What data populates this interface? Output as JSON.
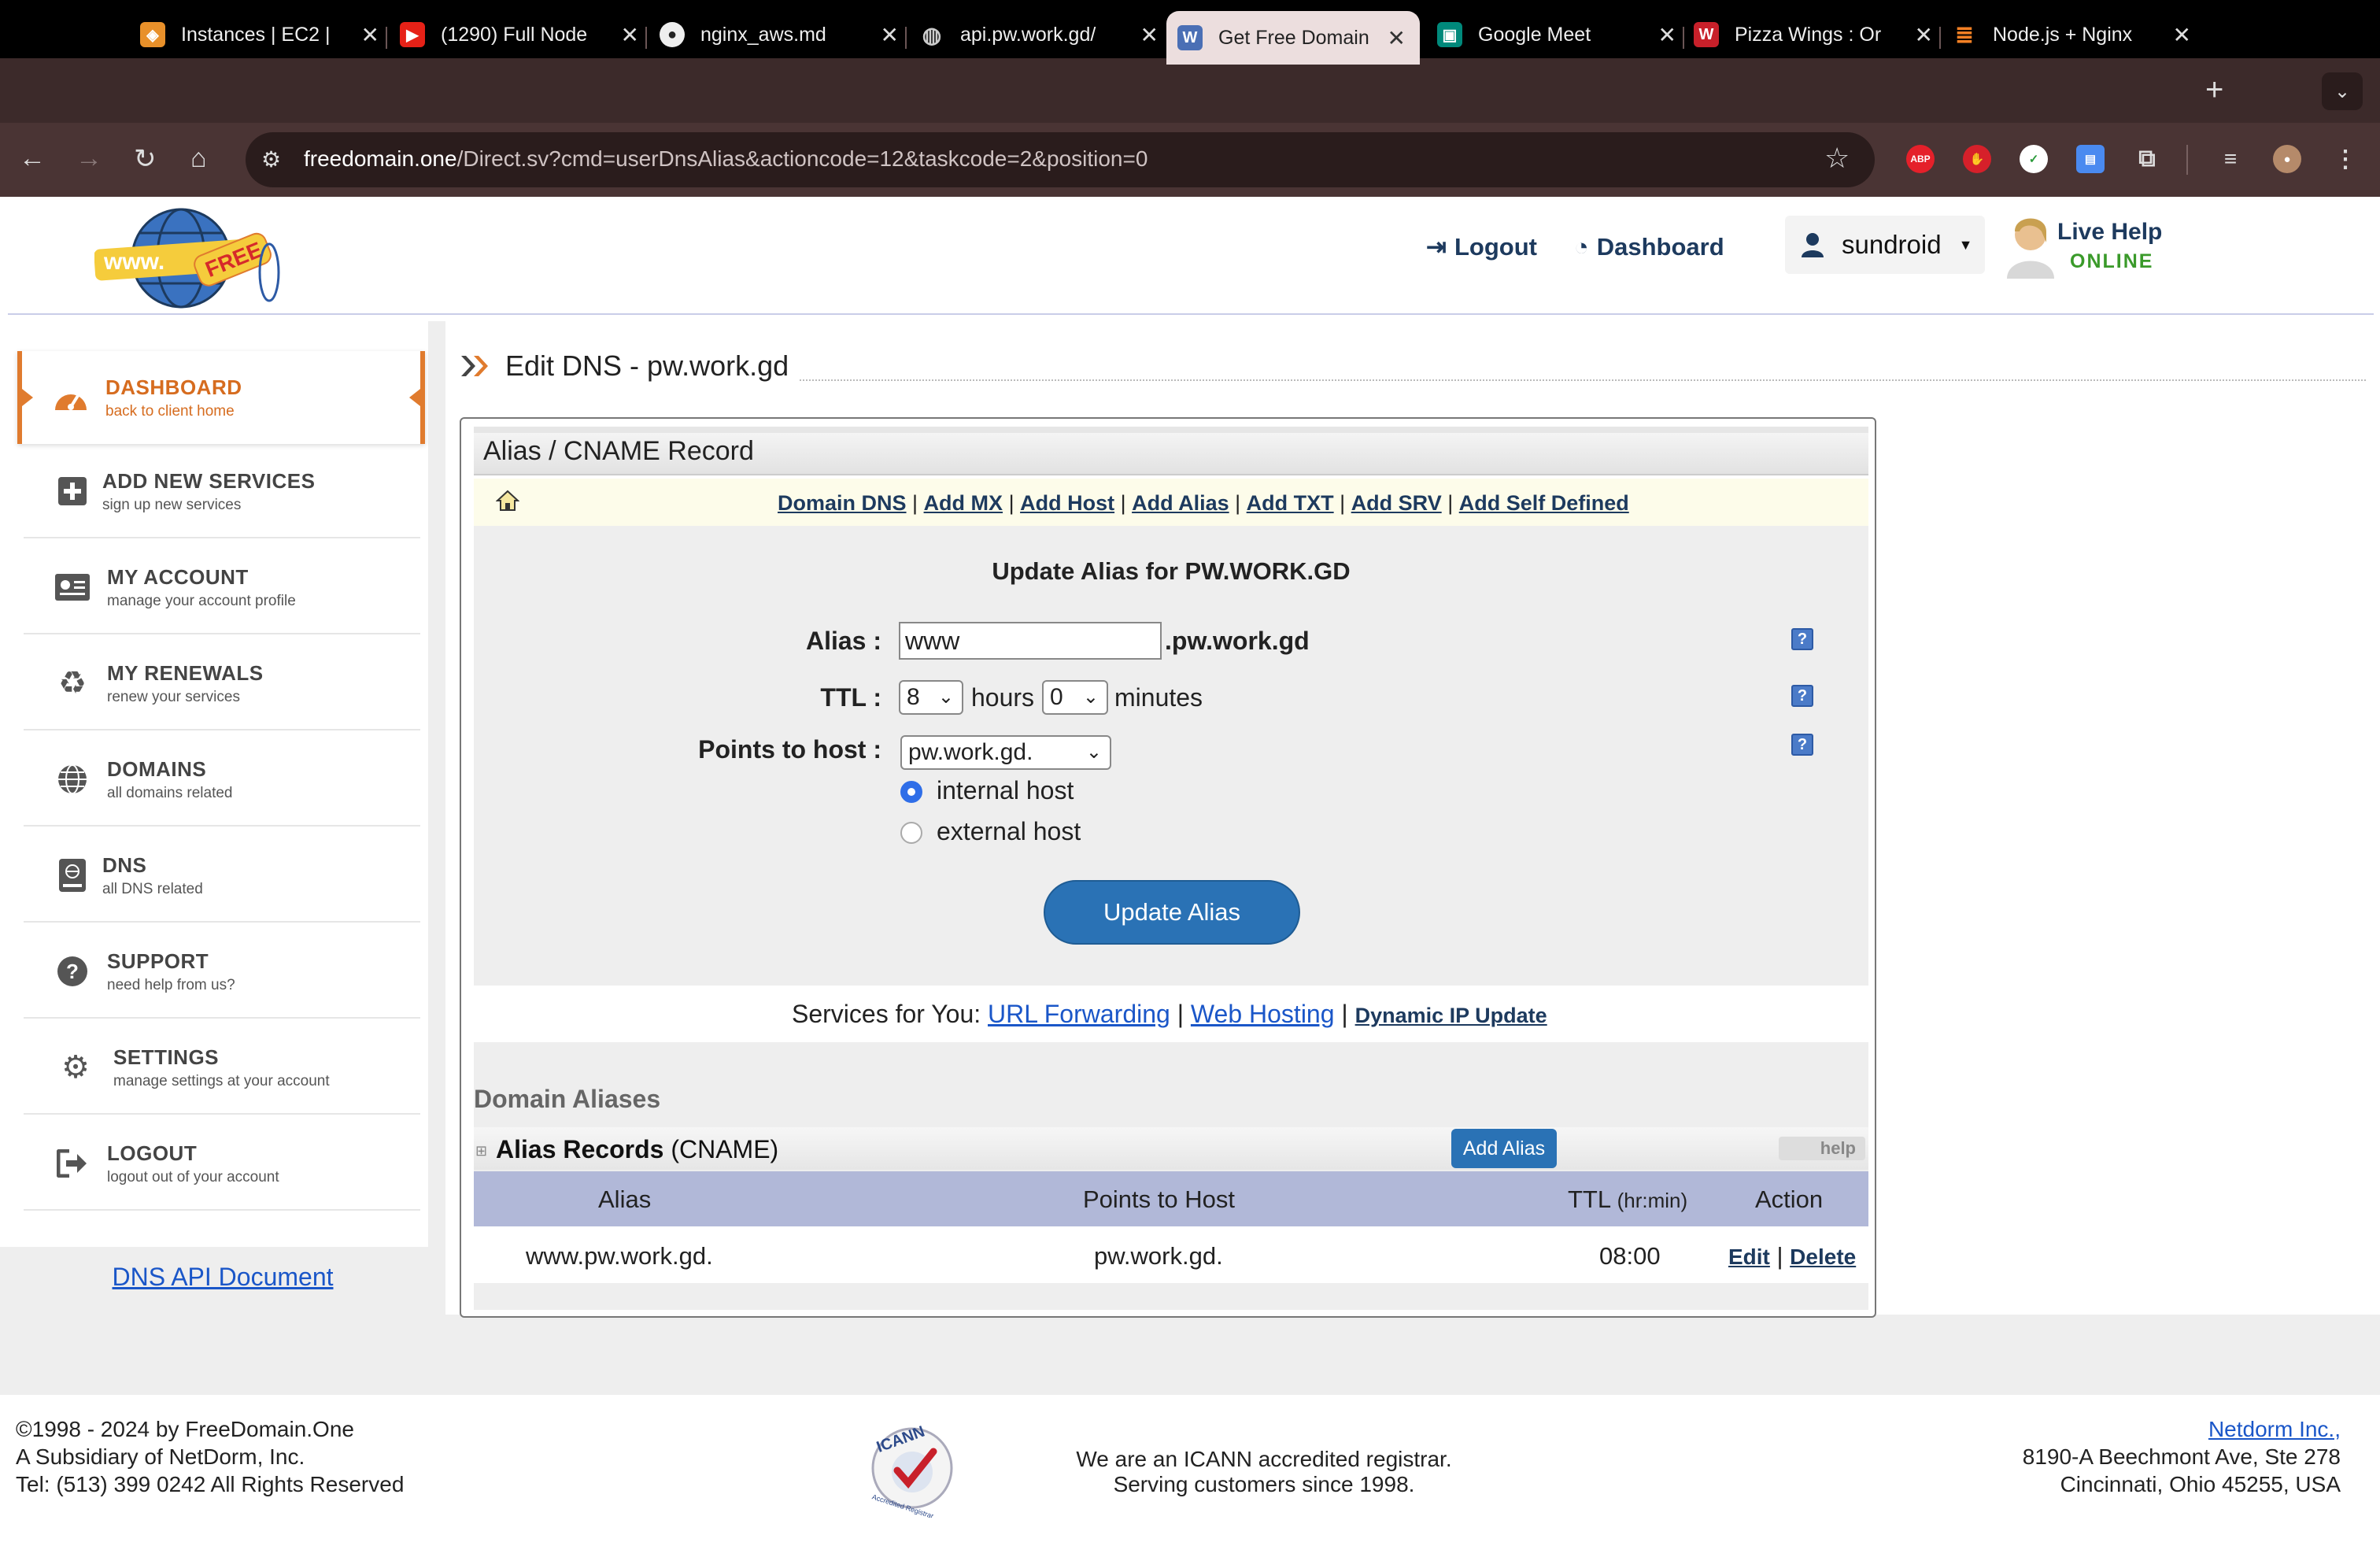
{
  "browser": {
    "tabs": [
      {
        "title": "Instances | EC2 |",
        "icon": "aws-icon",
        "color": "#e8902a"
      },
      {
        "title": "(1290) Full Node",
        "icon": "youtube-icon",
        "color": "#e62117"
      },
      {
        "title": "nginx_aws.md",
        "icon": "github-icon",
        "color": "#eeeeee"
      },
      {
        "title": "api.pw.work.gd/",
        "icon": "globe-icon",
        "color": "#cccccc"
      },
      {
        "title": "Get Free Domain",
        "icon": "freedomain-icon",
        "color": "#4a6fb5",
        "active": true
      },
      {
        "title": "Google Meet",
        "icon": "meet-icon",
        "color": "#00897b"
      },
      {
        "title": "Pizza Wings : Or",
        "icon": "w-icon",
        "color": "#c8202a"
      },
      {
        "title": "Node.js + Nginx",
        "icon": "stackoverflow-icon",
        "color": "#f48024"
      }
    ],
    "url_host": "freedomain.one",
    "url_path": "/Direct.sv?cmd=userDnsAlias&actioncode=12&taskcode=2&position=0",
    "ext_abp": "ABP"
  },
  "header": {
    "logo_text_www": "www.",
    "logo_text_free": "FREE",
    "logout": "Logout",
    "dashboard": "Dashboard",
    "username": "sundroid",
    "live_help": "Live Help",
    "online": "ONLINE"
  },
  "sidebar": {
    "items": [
      {
        "title": "DASHBOARD",
        "sub": "back to client home",
        "icon": "speedometer-icon"
      },
      {
        "title": "ADD NEW SERVICES",
        "sub": "sign up new services",
        "icon": "plus-square-icon"
      },
      {
        "title": "MY ACCOUNT",
        "sub": "manage your account profile",
        "icon": "id-card-icon"
      },
      {
        "title": "MY RENEWALS",
        "sub": "renew your services",
        "icon": "recycle-icon"
      },
      {
        "title": "DOMAINS",
        "sub": "all domains related",
        "icon": "globe-icon"
      },
      {
        "title": "DNS",
        "sub": "all DNS related",
        "icon": "dns-book-icon"
      },
      {
        "title": "SUPPORT",
        "sub": "need help from us?",
        "icon": "question-circle-icon"
      },
      {
        "title": "SETTINGS",
        "sub": "manage settings at your account",
        "icon": "gears-icon"
      },
      {
        "title": "LOGOUT",
        "sub": "logout out of your account",
        "icon": "logout-icon"
      }
    ],
    "dns_api": "DNS API Document"
  },
  "main": {
    "page_title": "Edit DNS - pw.work.gd",
    "panel_title": "Alias / CNAME Record",
    "links": [
      "Domain DNS",
      "Add MX",
      "Add Host",
      "Add Alias",
      "Add TXT",
      "Add SRV",
      "Add Self Defined"
    ],
    "form": {
      "title": "Update Alias for PW.WORK.GD",
      "alias_label": "Alias :",
      "alias_value": "www",
      "alias_suffix": ".pw.work.gd",
      "ttl_label": "TTL :",
      "ttl_hours": "8",
      "hours_text": "hours",
      "ttl_minutes": "0",
      "minutes_text": "minutes",
      "points_label": "Points to host :",
      "points_value": "pw.work.gd.",
      "internal": "internal host",
      "external": "external host",
      "update_button": "Update Alias",
      "help": "?"
    },
    "services": {
      "prefix": "Services for You:",
      "url_forwarding": "URL Forwarding",
      "web_hosting": "Web Hosting",
      "dynamic_ip": "Dynamic IP Update",
      "sep": "|"
    },
    "aliases": {
      "section_title": "Domain Aliases",
      "records_title": "Alias Records",
      "records_sub": "(CNAME)",
      "add_button": "Add Alias",
      "help": "help",
      "columns": {
        "alias": "Alias",
        "points": "Points to Host",
        "ttl": "TTL",
        "ttl_unit": "(hr:min)",
        "action": "Action"
      },
      "rows": [
        {
          "alias": "www.pw.work.gd.",
          "points": "pw.work.gd.",
          "ttl": "08:00",
          "edit": "Edit",
          "delete": "Delete"
        }
      ]
    }
  },
  "footer": {
    "left1": "©1998 - 2024 by FreeDomain.One",
    "left2": "A Subsidiary of NetDorm, Inc.",
    "left3": "Tel: (513) 399 0242 All Rights Reserved",
    "icann_text": "ICANN",
    "icann_sub": "Accredited Registrar",
    "mid1": "We are an ICANN accredited registrar.",
    "mid2": "Serving customers since 1998.",
    "right1": "Netdorm Inc.,",
    "right2": "8190-A Beechmont Ave, Ste 278",
    "right3": "Cincinnati, Ohio 45255, USA"
  }
}
